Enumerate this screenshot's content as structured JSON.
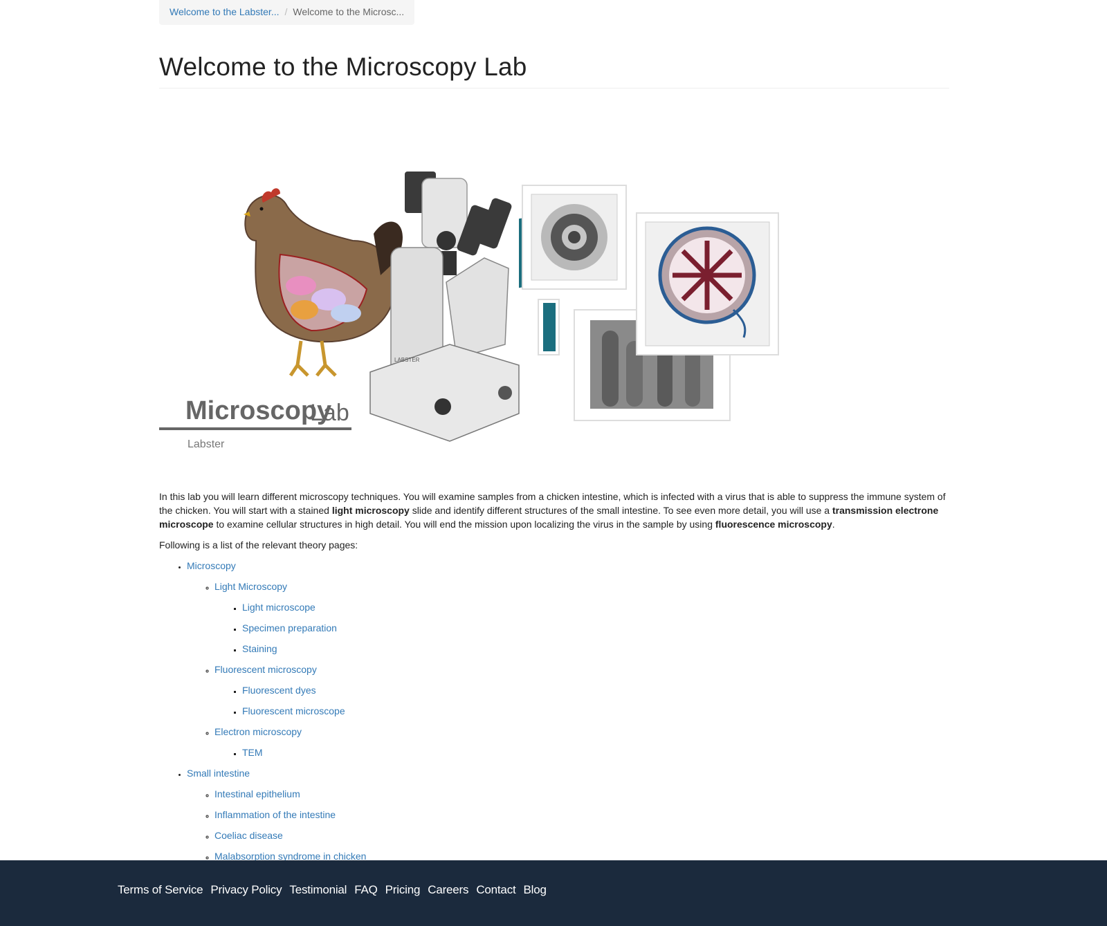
{
  "breadcrumb": {
    "items": [
      {
        "label": "Welcome to the Labster..."
      },
      {
        "label": "Welcome to the Microsc..."
      }
    ],
    "separator": "/"
  },
  "page": {
    "title": "Welcome to the Microscopy Lab"
  },
  "banner": {
    "logo_title_1": "Microscopy",
    "logo_title_2": "Lab",
    "logo_subtitle": "Labster",
    "microscope_brand": "LABSTER"
  },
  "intro": {
    "p1_a": "In this lab you will learn different microscopy techniques. You will examine samples from a chicken intestine, which is infected with a virus that is able to suppress the immune system of the chicken. You will start with a stained ",
    "p1_b": "light microscopy",
    "p1_c": " slide and identify different structures of the small intestine. To see even more detail, you will use a ",
    "p1_d": "transmission electrone microscope",
    "p1_e": " to examine cellular structures in high detail. You will end the mission upon localizing the virus in the sample by using ",
    "p1_f": "fluorescence microscopy",
    "p1_g": ".",
    "p2": "Following is a list of the relevant theory pages:"
  },
  "theory": {
    "microscopy": "Microscopy",
    "light_microscopy": "Light Microscopy",
    "light_microscope": "Light microscope",
    "specimen_preparation": "Specimen preparation",
    "staining": "Staining",
    "fluorescent_microscopy": "Fluorescent microscopy",
    "fluorescent_dyes": "Fluorescent dyes",
    "fluorescent_microscope": "Fluorescent microscope",
    "electron_microscopy": "Electron microscopy",
    "tem": "TEM",
    "small_intestine": "Small intestine",
    "intestinal_epithelium": "Intestinal epithelium",
    "inflammation": "Inflammation of the intestine",
    "coeliac": "Coeliac disease",
    "malabsorption": "Malabsorption syndrome in chicken"
  },
  "footer": {
    "links": [
      "Terms of Service",
      "Privacy Policy",
      "Testimonial",
      "FAQ",
      "Pricing",
      "Careers",
      "Contact",
      "Blog"
    ]
  },
  "colors": {
    "link": "#337ab7",
    "footer_bg": "#1b2a3d",
    "breadcrumb_bg": "#f5f5f5"
  }
}
